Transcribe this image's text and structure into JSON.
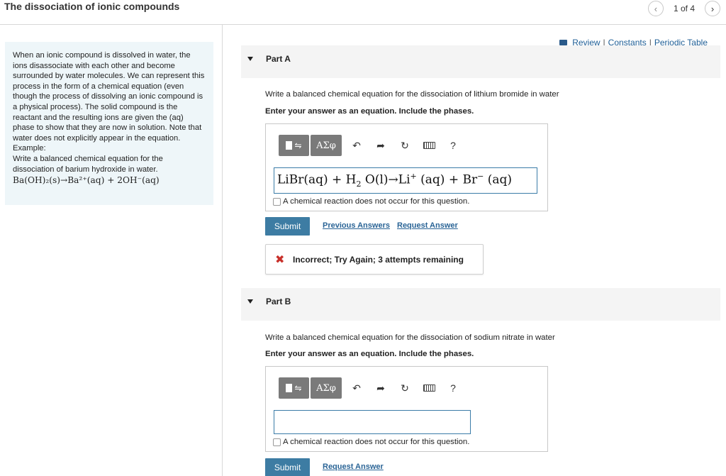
{
  "header": {
    "title": "The dissociation of ionic compounds",
    "page_indicator": "1 of 4",
    "prev_icon": "chevron-left-icon",
    "next_icon": "chevron-right-icon"
  },
  "intro": {
    "paragraph": "When an ionic compound is dissolved in water, the ions disassociate with each other and become surrounded by water molecules.  We can represent this process in the form of a chemical equation (even though the process of dissolving an ionic compound is a physical process).  The solid compound is the reactant and the resulting ions are given the (aq) phase to show that they are now in solution.  Note that water does not explicitly appear in the equation.",
    "example_label": "Example:",
    "example_text": "Write a balanced chemical equation for the dissociation of barium hydroxide in water.",
    "example_formula": "Ba(OH)₂(s)→Ba²⁺(aq) + 2OH⁻(aq)"
  },
  "resource_links": {
    "review": "Review",
    "separator": "|",
    "constants": "Constants",
    "periodic_table": "Periodic Table"
  },
  "toolbar": {
    "templates_icon": "templates-icon",
    "greek_label": "ΑΣφ",
    "undo_icon": "undo-icon",
    "redo_icon": "redo-icon",
    "reset_icon": "reset-icon",
    "keyboard_icon": "keyboard-icon",
    "help_label": "?"
  },
  "part_a": {
    "label": "Part A",
    "question": "Write a balanced chemical equation for the dissociation of lithium bromide in water",
    "instruction": "Enter your answer as an equation. Include the phases.",
    "answer": {
      "t1": "LiBr(aq) + H",
      "t1_sub": "2",
      "t2": " O(l)→Li",
      "t2_sup": "+",
      "t3": " (aq) + Br",
      "t3_sup": "−",
      "t4": " (aq)"
    },
    "no_reaction_label": "A chemical reaction does not occur for this question.",
    "submit_label": "Submit",
    "previous_answers_label": "Previous Answers",
    "request_answer_label": "Request Answer",
    "feedback": {
      "icon": "x-icon",
      "message": "Incorrect; Try Again; 3 attempts remaining",
      "color": "#c8302a"
    }
  },
  "part_b": {
    "label": "Part B",
    "question": "Write a balanced chemical equation for the dissociation of sodium nitrate in water",
    "instruction": "Enter your answer as an equation. Include the phases.",
    "answer": "",
    "no_reaction_label": "A chemical reaction does not occur for this question.",
    "submit_label": "Submit",
    "request_answer_label": "Request Answer"
  },
  "colors": {
    "accent": "#3d7ca3",
    "link": "#2a6496",
    "intro_bg": "#eef6f9"
  }
}
